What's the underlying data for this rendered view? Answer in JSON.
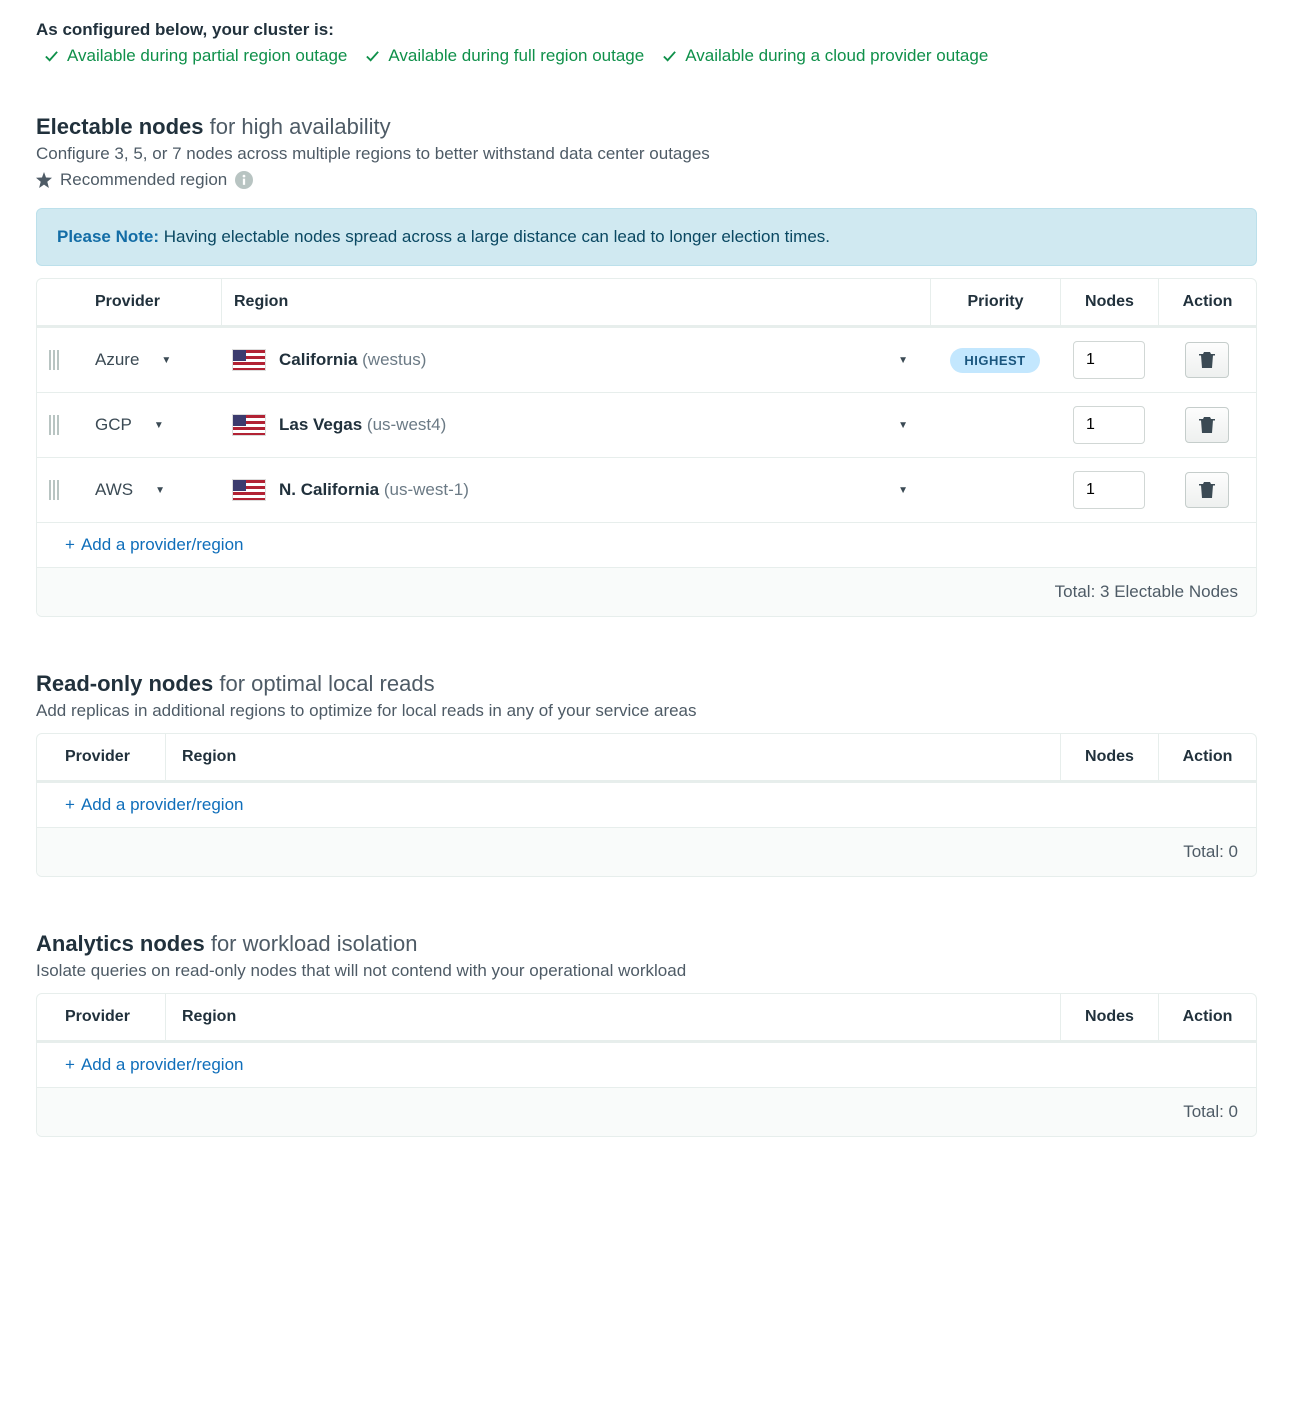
{
  "intro": {
    "label": "As configured below, your cluster is:",
    "availability": [
      "Available during partial region outage",
      "Available during full region outage",
      "Available during a cloud provider outage"
    ]
  },
  "electable": {
    "title_bold": "Electable nodes",
    "title_light": " for high availability",
    "desc": "Configure 3, 5, or 7 nodes across multiple regions to better withstand data center outages",
    "recommended_label": "Recommended region",
    "note_label": "Please Note:",
    "note_text": " Having electable nodes spread across a large distance can lead to longer election times.",
    "headers": {
      "provider": "Provider",
      "region": "Region",
      "priority": "Priority",
      "nodes": "Nodes",
      "action": "Action"
    },
    "rows": [
      {
        "provider": "Azure",
        "region_name": "California",
        "region_code": "(westus)",
        "priority": "HIGHEST",
        "nodes": "1"
      },
      {
        "provider": "GCP",
        "region_name": "Las Vegas",
        "region_code": "(us-west4)",
        "priority": "",
        "nodes": "1"
      },
      {
        "provider": "AWS",
        "region_name": "N. California",
        "region_code": "(us-west-1)",
        "priority": "",
        "nodes": "1"
      }
    ],
    "add_label": "Add a provider/region",
    "total_label": "Total: 3 Electable Nodes"
  },
  "readonly": {
    "title_bold": "Read-only nodes",
    "title_light": " for optimal local reads",
    "desc": "Add replicas in additional regions to optimize for local reads in any of your service areas",
    "headers": {
      "provider": "Provider",
      "region": "Region",
      "nodes": "Nodes",
      "action": "Action"
    },
    "add_label": "Add a provider/region",
    "total_label": "Total: 0"
  },
  "analytics": {
    "title_bold": "Analytics nodes",
    "title_light": " for workload isolation",
    "desc": "Isolate queries on read-only nodes that will not contend with your operational workload",
    "headers": {
      "provider": "Provider",
      "region": "Region",
      "nodes": "Nodes",
      "action": "Action"
    },
    "add_label": "Add a provider/region",
    "total_label": "Total: 0"
  }
}
